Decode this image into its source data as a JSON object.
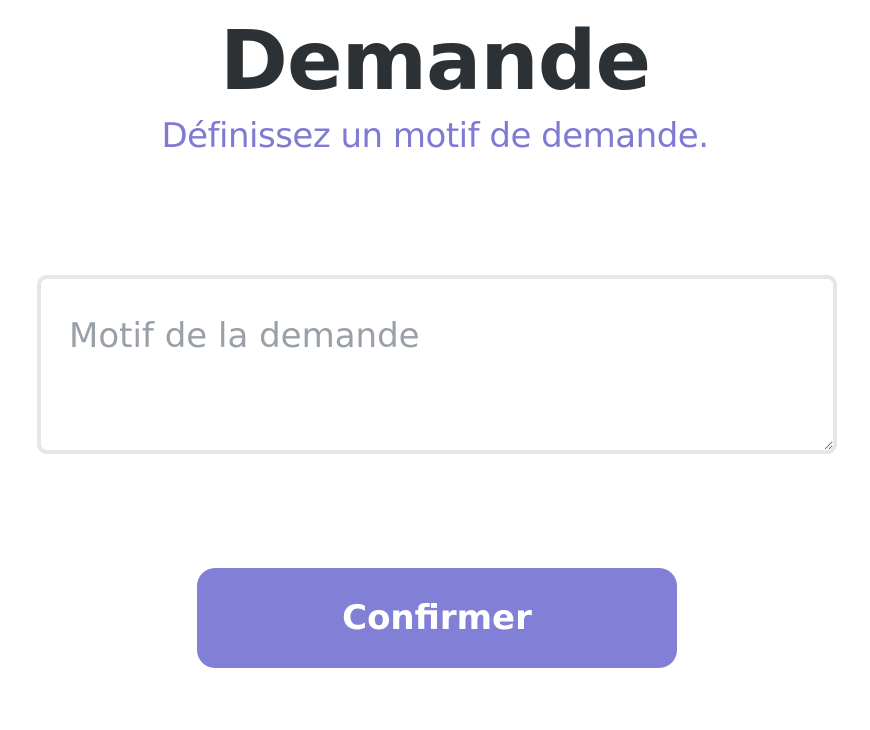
{
  "header": {
    "title": "Demande",
    "subtitle": "Définissez un motif de demande."
  },
  "form": {
    "reason": {
      "value": "",
      "placeholder": "Motif de la demande"
    },
    "confirm_label": "Confirmer"
  },
  "colors": {
    "title": "#2b3135",
    "accent": "#8280d6",
    "subtitle": "#7f7bd3",
    "placeholder": "#99a0a8",
    "input_border": "#e5e6e9"
  }
}
